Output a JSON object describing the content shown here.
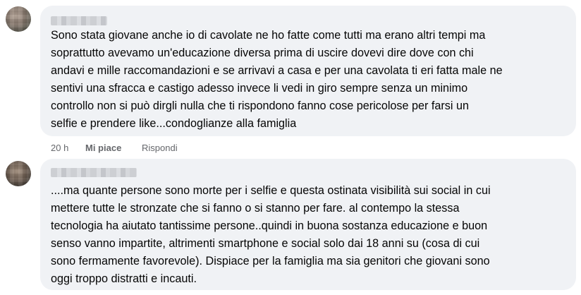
{
  "comments": [
    {
      "lines": [
        "Sono stata giovane anche io di cavolate ne ho fatte come tutti ma erano altri tempi ma",
        "soprattutto avevamo un'educazione diversa prima di uscire dovevi dire dove con chi",
        "andavi e mille raccomandazioni e se arrivavi a casa e per una cavolata ti eri fatta male ne",
        "sentivi una sfracca e castigo adesso invece li vedi in giro sempre senza un minimo",
        "controllo non si può dirgli nulla che ti rispondono fanno cose pericolose per farsi un",
        "selfie e prendere like...condoglianze alla famiglia"
      ],
      "time": "20 h",
      "like_label": "Mi piace",
      "reply_label": "Rispondi"
    },
    {
      "lines": [
        "....ma quante persone sono morte per i selfie e questa ostinata visibilità sui social in cui",
        "mettere tutte le stronzate che si fanno o si stanno per fare. al contempo la stessa",
        "tecnologia ha aiutato tantissime persone..quindi in buona sostanza educazione e buon",
        "senso vanno impartite, altrimenti smartphone e social solo dai 18 anni su (cosa di cui",
        "sono fermamente favorevole). Dispiace per la famiglia ma sia genitori che giovani sono",
        "oggi troppo distratti e incauti."
      ]
    }
  ]
}
